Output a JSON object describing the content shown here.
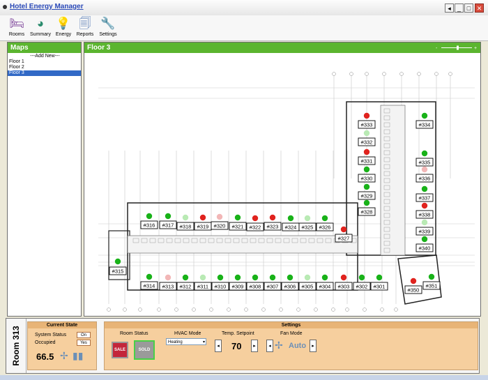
{
  "window": {
    "title": "Hotel Energy Manager"
  },
  "toolbar": {
    "items": [
      {
        "label": "Rooms",
        "icon": "bed-icon"
      },
      {
        "label": "Summary",
        "icon": "pie-chart-icon"
      },
      {
        "label": "Energy",
        "icon": "lightbulb-icon"
      },
      {
        "label": "Reports",
        "icon": "documents-icon"
      },
      {
        "label": "Settings",
        "icon": "wrench-icon"
      }
    ]
  },
  "maps": {
    "title": "Maps",
    "items": [
      "---Add New---",
      "Floor 1",
      "Floor 2",
      "Floor 3"
    ],
    "selected": "Floor 3"
  },
  "floor": {
    "title": "Floor 3",
    "rooms": [
      {
        "id": "#333",
        "status": "red"
      },
      {
        "id": "#334",
        "status": "green"
      },
      {
        "id": "#332",
        "status": "light-green"
      },
      {
        "id": "#331",
        "status": "red"
      },
      {
        "id": "#335",
        "status": "green"
      },
      {
        "id": "#330",
        "status": "green"
      },
      {
        "id": "#336",
        "status": "pink"
      },
      {
        "id": "#329",
        "status": "green"
      },
      {
        "id": "#337",
        "status": "green"
      },
      {
        "id": "#328",
        "status": "green"
      },
      {
        "id": "#338",
        "status": "red"
      },
      {
        "id": "#339",
        "status": "light-green"
      },
      {
        "id": "#340",
        "status": "green"
      },
      {
        "id": "#327",
        "status": "red"
      },
      {
        "id": "#316",
        "status": "green"
      },
      {
        "id": "#317",
        "status": "green"
      },
      {
        "id": "#318",
        "status": "light-green"
      },
      {
        "id": "#319",
        "status": "red"
      },
      {
        "id": "#320",
        "status": "pink"
      },
      {
        "id": "#321",
        "status": "green"
      },
      {
        "id": "#322",
        "status": "red"
      },
      {
        "id": "#323",
        "status": "red"
      },
      {
        "id": "#324",
        "status": "green"
      },
      {
        "id": "#325",
        "status": "light-green"
      },
      {
        "id": "#326",
        "status": "green"
      },
      {
        "id": "#315",
        "status": "green"
      },
      {
        "id": "#314",
        "status": "green"
      },
      {
        "id": "#313",
        "status": "pink"
      },
      {
        "id": "#312",
        "status": "green"
      },
      {
        "id": "#311",
        "status": "light-green"
      },
      {
        "id": "#310",
        "status": "green"
      },
      {
        "id": "#309",
        "status": "green"
      },
      {
        "id": "#308",
        "status": "green"
      },
      {
        "id": "#307",
        "status": "green"
      },
      {
        "id": "#306",
        "status": "green"
      },
      {
        "id": "#305",
        "status": "light-green"
      },
      {
        "id": "#304",
        "status": "green"
      },
      {
        "id": "#303",
        "status": "red"
      },
      {
        "id": "#302",
        "status": "green"
      },
      {
        "id": "#301",
        "status": "green"
      },
      {
        "id": "#350",
        "status": "red"
      },
      {
        "id": "#351",
        "status": "green"
      }
    ]
  },
  "room": {
    "label": "Room 313",
    "current_state": {
      "title": "Current State",
      "system_status_label": "System Status",
      "system_status_value": "On",
      "occupied_label": "Occupied",
      "occupied_value": "Yes",
      "temperature": "66.5"
    },
    "settings": {
      "title": "Settings",
      "room_status_label": "Room Status",
      "for_sale_label": "SALE",
      "sold_label": "SOLD",
      "hvac_mode_label": "HVAC Mode",
      "hvac_mode_value": "Heating",
      "setpoint_label": "Temp. Setpoint",
      "setpoint_value": "70",
      "fan_mode_label": "Fan Mode",
      "fan_mode_value": "Auto"
    }
  },
  "colors": {
    "panel_header": "#5bb52f",
    "status_red": "#e0231e",
    "status_green": "#19b219",
    "status_light_green": "#b9eab4",
    "status_pink": "#f2b7b7",
    "settings_bg": "#f6cf9e"
  }
}
